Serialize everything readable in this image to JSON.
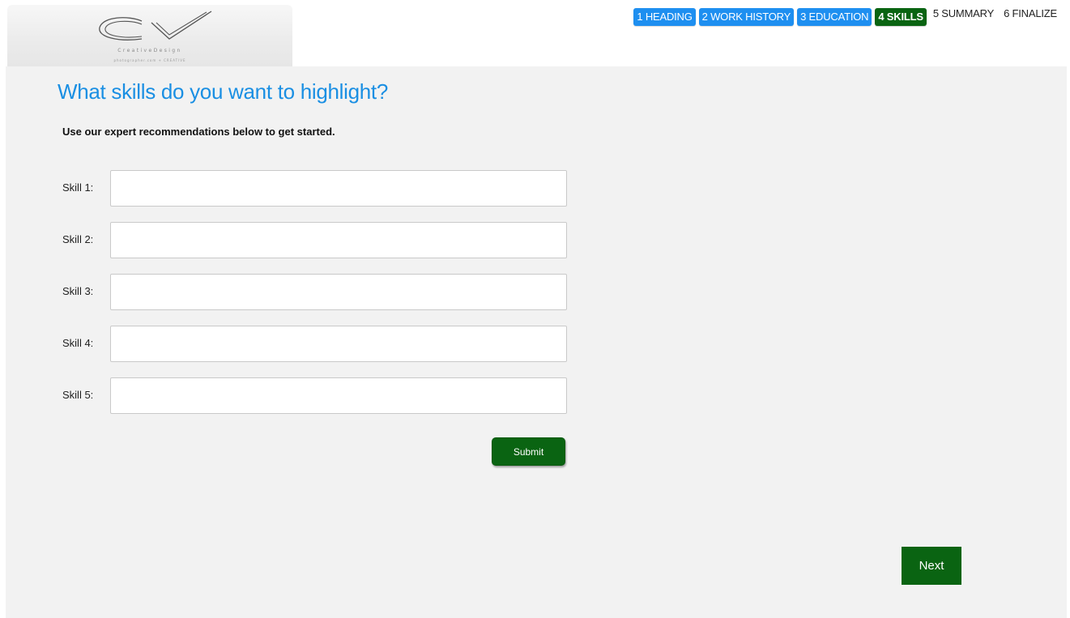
{
  "logo": {
    "mark": "CV",
    "tagline": "CreativeDesign",
    "sub": "photographer.com + CREATIVE"
  },
  "steps": [
    {
      "label": "1 HEADING",
      "state": "done"
    },
    {
      "label": "2 WORK HISTORY",
      "state": "done"
    },
    {
      "label": "3 EDUCATION",
      "state": "done"
    },
    {
      "label": "4 SKILLS",
      "state": "current"
    },
    {
      "label": "5 SUMMARY",
      "state": "todo"
    },
    {
      "label": "6 FINALIZE",
      "state": "todo"
    }
  ],
  "page": {
    "title": "What skills do you want to highlight?",
    "subtitle": "Use our expert recommendations below to get started."
  },
  "skills": [
    {
      "label": "Skill 1:",
      "value": ""
    },
    {
      "label": "Skill 2:",
      "value": ""
    },
    {
      "label": "Skill 3:",
      "value": ""
    },
    {
      "label": "Skill 4:",
      "value": ""
    },
    {
      "label": "Skill 5:",
      "value": ""
    }
  ],
  "buttons": {
    "submit": "Submit",
    "next": "Next"
  },
  "colors": {
    "accent_blue": "#1e8ff0",
    "accent_green": "#0a6412",
    "title_blue": "#1a8fe3",
    "panel_bg": "#f2f2f2"
  }
}
